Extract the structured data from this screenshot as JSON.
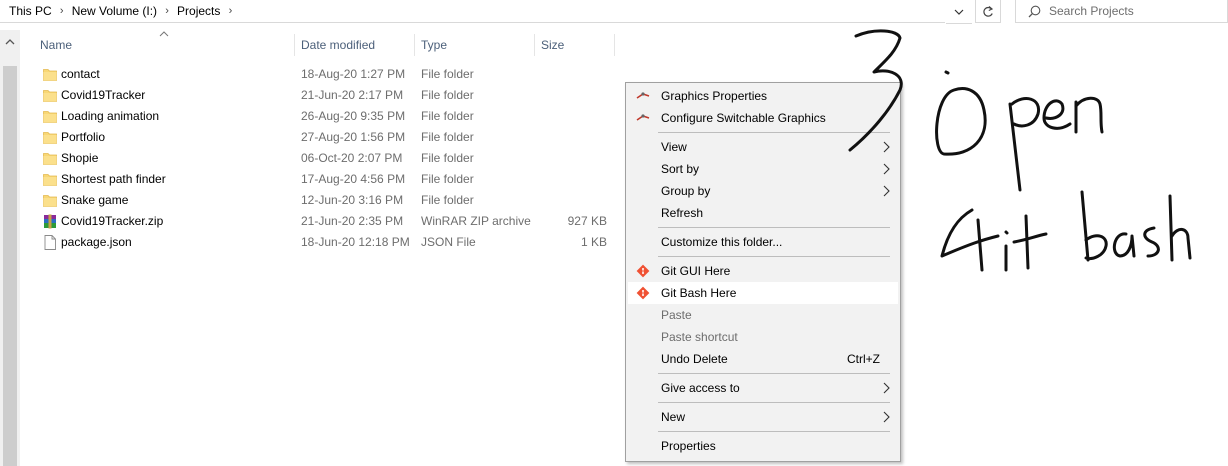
{
  "breadcrumb": [
    "This PC",
    "New Volume (I:)",
    "Projects"
  ],
  "search": {
    "placeholder": "Search Projects"
  },
  "columns": {
    "name": "Name",
    "date": "Date modified",
    "type": "Type",
    "size": "Size"
  },
  "files": [
    {
      "name": "contact",
      "date": "18-Aug-20 1:27 PM",
      "type": "File folder",
      "size": "",
      "icon": "folder-icon"
    },
    {
      "name": "Covid19Tracker",
      "date": "21-Jun-20 2:17 PM",
      "type": "File folder",
      "size": "",
      "icon": "folder-icon"
    },
    {
      "name": "Loading animation",
      "date": "26-Aug-20 9:35 PM",
      "type": "File folder",
      "size": "",
      "icon": "folder-icon"
    },
    {
      "name": "Portfolio",
      "date": "27-Aug-20 1:56 PM",
      "type": "File folder",
      "size": "",
      "icon": "folder-icon"
    },
    {
      "name": "Shopie",
      "date": "06-Oct-20 2:07 PM",
      "type": "File folder",
      "size": "",
      "icon": "folder-icon"
    },
    {
      "name": "Shortest path finder",
      "date": "17-Aug-20 4:56 PM",
      "type": "File folder",
      "size": "",
      "icon": "folder-icon"
    },
    {
      "name": "Snake game",
      "date": "12-Jun-20 3:16 PM",
      "type": "File folder",
      "size": "",
      "icon": "folder-icon"
    },
    {
      "name": "Covid19Tracker.zip",
      "date": "21-Jun-20 2:35 PM",
      "type": "WinRAR ZIP archive",
      "size": "927 KB",
      "icon": "winrar-archive-icon"
    },
    {
      "name": "package.json",
      "date": "18-Jun-20 12:18 PM",
      "type": "JSON File",
      "size": "1 KB",
      "icon": "file-icon"
    }
  ],
  "context_menu": {
    "graphics_properties": "Graphics Properties",
    "configure_switchable_graphics": "Configure Switchable Graphics",
    "view": "View",
    "sort_by": "Sort by",
    "group_by": "Group by",
    "refresh": "Refresh",
    "customize_folder": "Customize this folder...",
    "git_gui": "Git GUI Here",
    "git_bash": "Git Bash Here",
    "paste": "Paste",
    "paste_shortcut": "Paste shortcut",
    "undo_delete": "Undo Delete",
    "undo_delete_shortcut": "Ctrl+Z",
    "give_access": "Give access to",
    "new": "New",
    "properties": "Properties"
  },
  "colors": {
    "header_text": "#4c607a",
    "menu_bg": "#f2f2f2",
    "menu_hover": "#ffffff",
    "folder": "#f8d775",
    "git": "#f05133"
  }
}
